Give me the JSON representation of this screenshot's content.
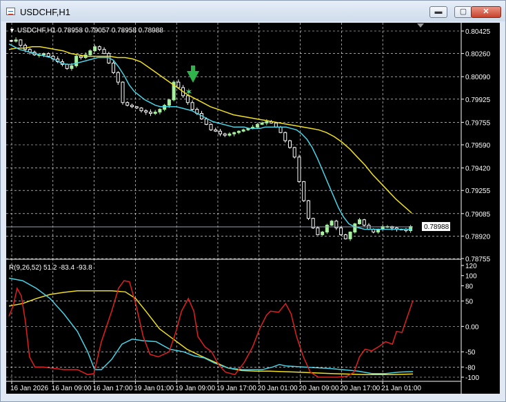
{
  "window": {
    "title": "USDCHF,H1",
    "minimize_label": "▬",
    "maximize_label": "▢",
    "close_label": "✕"
  },
  "price_panel": {
    "header": "USDCHF,H1  0.78958 0.79057 0.78958 0.78988",
    "current_price": "0.78988",
    "colors": {
      "background": "#000000",
      "grid": "#ffffff",
      "bull": "#a8f0a0",
      "bear": "#ffffff",
      "ma_fast": "#49d3e6",
      "ma_slow": "#f0e020",
      "signal": "#2fb34a"
    }
  },
  "osc_panel": {
    "header": "R(9,26,52) 51.2 -83.4 -93.8",
    "colors": {
      "fast": "#e02020",
      "mid": "#49d3e6",
      "slow": "#f0e020"
    }
  },
  "chart_data": [
    {
      "type": "candlestick",
      "title": "USDCHF,H1",
      "ohlc_last": {
        "open": 0.78958,
        "high": 0.79057,
        "low": 0.78958,
        "close": 0.78988
      },
      "y_ticks": [
        "0.80425",
        "0.80260",
        "0.80090",
        "0.79925",
        "0.79755",
        "0.79590",
        "0.79420",
        "0.79255",
        "0.79085",
        "0.78920",
        "0.78755"
      ],
      "ylim": [
        0.78755,
        0.80425
      ],
      "x_labels": [
        "16 Jan 2026",
        "16 Jan 09:00",
        "16 Jan 17:00",
        "19 Jan 01:00",
        "19 Jan 09:00",
        "19 Jan 17:00",
        "20 Jan 01:00",
        "20 Jan 09:00",
        "20 Jan 17:00",
        "21 Jan 01:00"
      ],
      "close_series": [
        0.8035,
        0.8036,
        0.8032,
        0.8029,
        0.8027,
        0.8025,
        0.8025,
        0.8026,
        0.8024,
        0.8022,
        0.802,
        0.8018,
        0.8015,
        0.8017,
        0.8024,
        0.8023,
        0.8025,
        0.8028,
        0.8031,
        0.8029,
        0.8026,
        0.8019,
        0.8012,
        0.8005,
        0.799,
        0.7988,
        0.7987,
        0.7986,
        0.7984,
        0.7983,
        0.7982,
        0.7983,
        0.7985,
        0.7988,
        0.7992,
        0.8005,
        0.8001,
        0.7995,
        0.799,
        0.7985,
        0.7982,
        0.7978,
        0.7974,
        0.797,
        0.7969,
        0.7967,
        0.7966,
        0.7967,
        0.7968,
        0.7969,
        0.797,
        0.7971,
        0.7972,
        0.7974,
        0.7975,
        0.7976,
        0.7975,
        0.7972,
        0.7968,
        0.7962,
        0.7957,
        0.795,
        0.7932,
        0.7918,
        0.7905,
        0.7898,
        0.7893,
        0.7895,
        0.79,
        0.7903,
        0.7898,
        0.7893,
        0.789,
        0.7895,
        0.7901,
        0.7904,
        0.79,
        0.7897,
        0.7895,
        0.7897,
        0.7899,
        0.7899,
        0.7898,
        0.7897,
        0.7897,
        0.7896,
        0.7899
      ],
      "ma_fast": [
        0.8033,
        0.8031,
        0.8029,
        0.8028,
        0.8027,
        0.8026,
        0.8025,
        0.8024,
        0.8023,
        0.8021,
        0.8019,
        0.8018,
        0.8018,
        0.8019,
        0.802,
        0.8021,
        0.8022,
        0.8023,
        0.8023,
        0.8023,
        0.8021,
        0.8016,
        0.801,
        0.8003,
        0.7998,
        0.7995,
        0.7992,
        0.799,
        0.7988,
        0.7987,
        0.7987,
        0.7987,
        0.7987,
        0.7986,
        0.7985,
        0.7984,
        0.7982,
        0.798,
        0.7978,
        0.7976,
        0.7975,
        0.7974,
        0.7973,
        0.7972,
        0.7972,
        0.7972,
        0.7971,
        0.7971,
        0.7971,
        0.7972,
        0.7972,
        0.7972,
        0.7972,
        0.7972,
        0.7971,
        0.797,
        0.7967,
        0.7963,
        0.7957,
        0.7949,
        0.794,
        0.7931,
        0.7922,
        0.7913,
        0.7906,
        0.7901,
        0.7899,
        0.7898,
        0.7897,
        0.7897,
        0.7897,
        0.7897,
        0.7897,
        0.7897,
        0.7897,
        0.7897,
        0.7897,
        0.7897
      ],
      "ma_slow": [
        0.8029,
        0.803,
        0.803,
        0.8031,
        0.8031,
        0.803,
        0.8029,
        0.8028,
        0.8026,
        0.8025,
        0.8024,
        0.8024,
        0.8024,
        0.8024,
        0.8023,
        0.8023,
        0.8022,
        0.802,
        0.8016,
        0.8012,
        0.8008,
        0.8004,
        0.8,
        0.7996,
        0.7993,
        0.799,
        0.7987,
        0.7985,
        0.7983,
        0.7981,
        0.798,
        0.7979,
        0.7978,
        0.7977,
        0.7976,
        0.7975,
        0.7974,
        0.7973,
        0.7972,
        0.7971,
        0.797,
        0.7968,
        0.7965,
        0.7961,
        0.7956,
        0.795,
        0.7944,
        0.7937,
        0.7931,
        0.7925,
        0.7919,
        0.7914,
        0.7909
      ]
    },
    {
      "type": "line",
      "title": "R(9,26,52)",
      "y_ticks": [
        "120",
        "100",
        "80",
        "50",
        "0.00",
        "-50",
        "-80",
        "-100"
      ],
      "ylim": [
        -100,
        120
      ],
      "series": [
        {
          "name": "R9",
          "last": 51.2
        },
        {
          "name": "R26",
          "last": -83.4
        },
        {
          "name": "R52",
          "last": -93.8
        }
      ]
    }
  ]
}
